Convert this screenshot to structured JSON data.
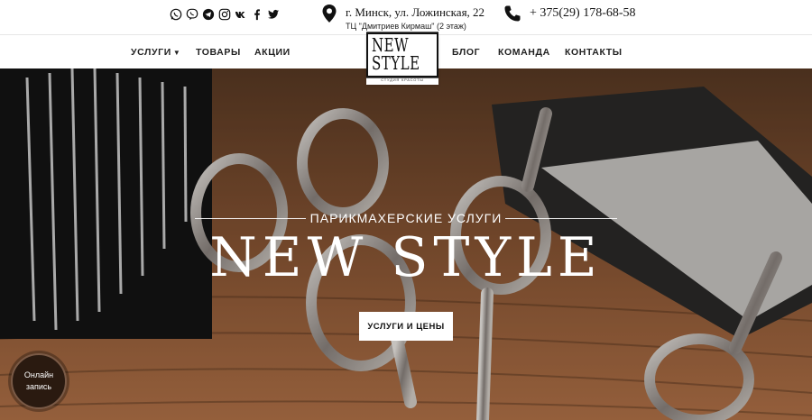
{
  "topbar": {
    "socials": [
      {
        "icon": "whatsapp-icon"
      },
      {
        "icon": "viber-icon"
      },
      {
        "icon": "telegram-icon"
      },
      {
        "icon": "instagram-icon"
      },
      {
        "icon": "vk-icon"
      },
      {
        "icon": "facebook-icon"
      },
      {
        "icon": "twitter-icon"
      }
    ],
    "address": "г. Минск, ул. Ложинская, 22",
    "address_sub": "ТЦ \"Дмитриев Кирмаш\" (2 этаж)",
    "phone": "+ 375(29) 178-68-58"
  },
  "nav": {
    "services": "УСЛУГИ",
    "products": "ТОВАРЫ",
    "promotions": "АКЦИИ",
    "blog": "БЛОГ",
    "team": "КОМАНДА",
    "contacts": "КОНТАКТЫ"
  },
  "logo": {
    "title": "NEW STYLE",
    "subtitle": "СТУДИЯ КРАСОТЫ"
  },
  "hero": {
    "subtitle": "ПАРИКМАХЕРСКИЕ УСЛУГИ",
    "title": "NEW STYLE",
    "button": "УСЛУГИ И ЦЕНЫ"
  },
  "online_booking": {
    "line1": "Онлайн",
    "line2": "запись"
  },
  "colors": {
    "hero_dark": "#2b1a10",
    "hero_wood": "#a86a3d",
    "text": "#111111"
  }
}
